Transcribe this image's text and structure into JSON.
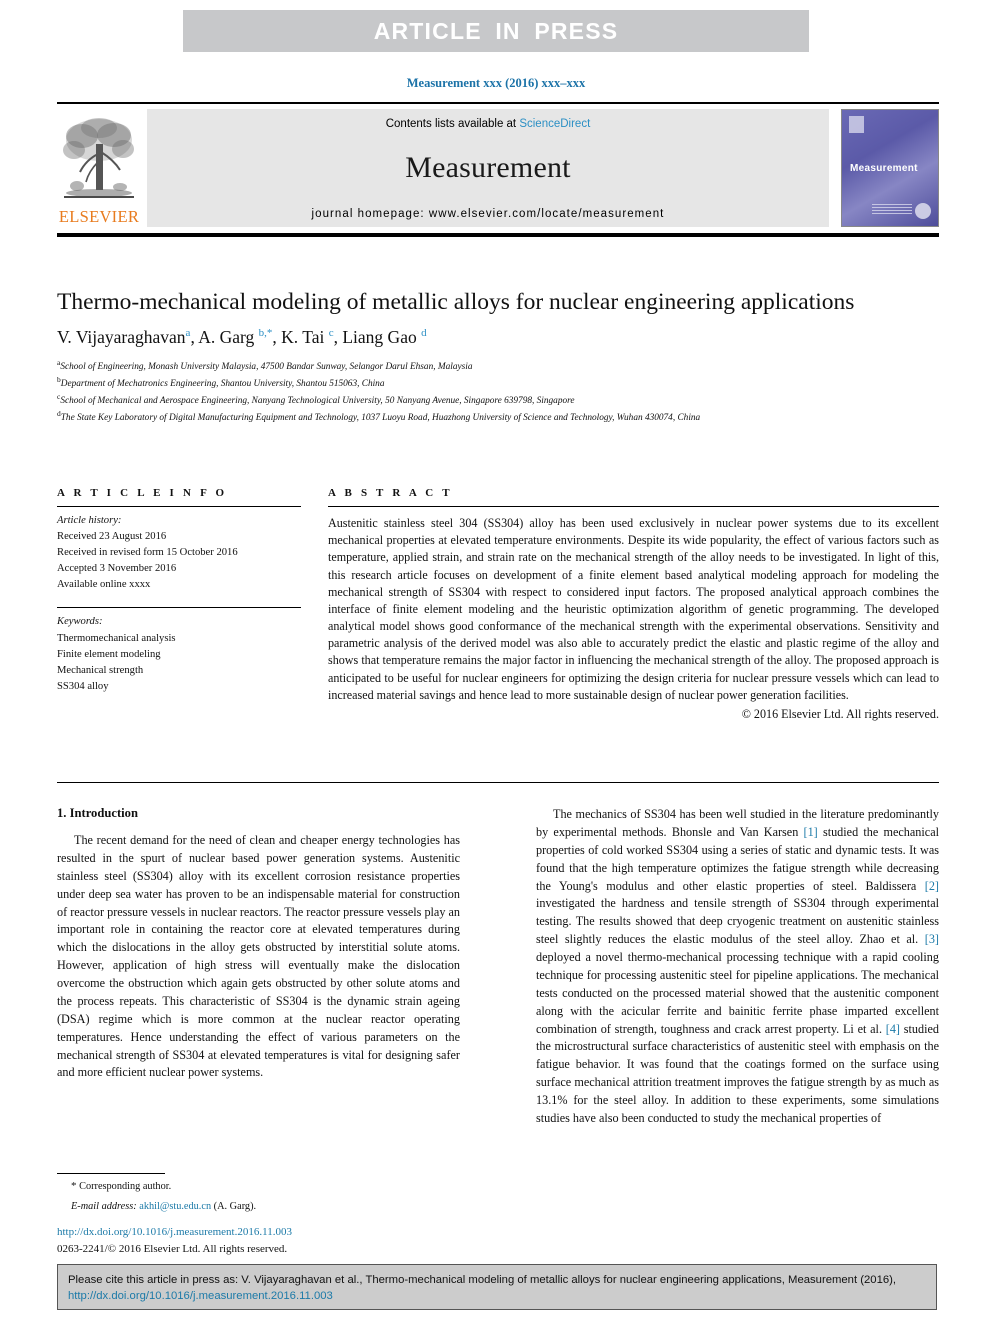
{
  "banner": {
    "label": "ARTICLE  IN  PRESS",
    "bg_color": "#c7c8ca",
    "text_color": "#ffffff"
  },
  "running_head": "Measurement xxx (2016) xxx–xxx",
  "masthead": {
    "contents_prefix": "Contents lists available at ",
    "sciencedirect": "ScienceDirect",
    "journal_name": "Measurement",
    "homepage": "journal homepage: www.elsevier.com/locate/measurement",
    "publisher_logo_text": "ELSEVIER",
    "publisher_logo_color": "#e87b1e",
    "cover_title": "Measurement",
    "link_color": "#2b8fc4"
  },
  "article": {
    "title": "Thermo-mechanical modeling of metallic alloys for nuclear engineering applications",
    "authors_plain": "V. Vijayaraghavan a, A. Garg b,*, K. Tai c, Liang Gao d",
    "author_list": [
      {
        "name": "V. Vijayaraghavan",
        "sup": "a"
      },
      {
        "name": "A. Garg",
        "sup": "b,*"
      },
      {
        "name": "K. Tai",
        "sup": "c"
      },
      {
        "name": "Liang Gao",
        "sup": "d"
      }
    ],
    "affiliations": [
      {
        "marker": "a",
        "text": "School of Engineering, Monash University Malaysia, 47500 Bandar Sunway, Selangor Darul Ehsan, Malaysia"
      },
      {
        "marker": "b",
        "text": "Department of Mechatronics Engineering, Shantou University, Shantou 515063, China"
      },
      {
        "marker": "c",
        "text": "School of Mechanical and Aerospace Engineering, Nanyang Technological University, 50 Nanyang Avenue, Singapore 639798, Singapore"
      },
      {
        "marker": "d",
        "text": "The State Key Laboratory of Digital Manufacturing Equipment and Technology, 1037 Luoyu Road, Huazhong University of Science and Technology, Wuhan 430074, China"
      }
    ]
  },
  "article_info": {
    "heading": "A R T I C L E   I N F O",
    "history_label": "Article history:",
    "history": [
      "Received 23 August 2016",
      "Received in revised form 15 October 2016",
      "Accepted 3 November 2016",
      "Available online xxxx"
    ],
    "keywords_label": "Keywords:",
    "keywords": [
      "Thermomechanical analysis",
      "Finite element modeling",
      "Mechanical strength",
      "SS304 alloy"
    ]
  },
  "abstract": {
    "heading": "A B S T R A C T",
    "text": "Austenitic stainless steel 304 (SS304) alloy has been used exclusively in nuclear power systems due to its excellent mechanical properties at elevated temperature environments. Despite its wide popularity, the effect of various factors such as temperature, applied strain, and strain rate on the mechanical strength of the alloy needs to be investigated. In light of this, this research article focuses on development of a finite element based analytical modeling approach for modeling the mechanical strength of SS304 with respect to considered input factors. The proposed analytical approach combines the interface of finite element modeling and the heuristic optimization algorithm of genetic programming. The developed analytical model shows good conformance of the mechanical strength with the experimental observations. Sensitivity and parametric analysis of the derived model was also able to accurately predict the elastic and plastic regime of the alloy and shows that temperature remains the major factor in influencing the mechanical strength of the alloy. The proposed approach is anticipated to be useful for nuclear engineers for optimizing the design criteria for nuclear pressure vessels which can lead to increased material savings and hence lead to more sustainable design of nuclear power generation facilities.",
    "copyright": "© 2016 Elsevier Ltd. All rights reserved."
  },
  "body": {
    "section_title": "1. Introduction",
    "left_paragraph": "The recent demand for the need of clean and cheaper energy technologies has resulted in the spurt of nuclear based power generation systems. Austenitic stainless steel (SS304) alloy with its excellent corrosion resistance properties under deep sea water has proven to be an indispensable material for construction of reactor pressure vessels in nuclear reactors. The reactor pressure vessels play an important role in containing the reactor core at elevated temperatures during which the dislocations in the alloy gets obstructed by interstitial solute atoms. However, application of high stress will eventually make the dislocation overcome the obstruction which again gets obstructed by other solute atoms and the process repeats. This characteristic of SS304 is the dynamic strain ageing (DSA) regime which is more common at the nuclear reactor operating temperatures. Hence understanding the effect of various parameters on the mechanical strength of SS304 at elevated temperatures is vital for designing safer and more efficient nuclear power systems.",
    "right_paragraph_parts": [
      "The mechanics of SS304 has been well studied in the literature predominantly by experimental methods. Bhonsle and Van Karsen ",
      "[1]",
      " studied the mechanical properties of cold worked SS304 using a series of static and dynamic tests. It was found that the high temperature optimizes the fatigue strength while decreasing the Young's modulus and other elastic properties of steel. Baldissera ",
      "[2]",
      " investigated the hardness and tensile strength of SS304 through experimental testing. The results showed that deep cryogenic treatment on austenitic stainless steel slightly reduces the elastic modulus of the steel alloy. Zhao et al. ",
      "[3]",
      " deployed a novel thermo-mechanical processing technique with a rapid cooling technique for processing austenitic steel for pipeline applications. The mechanical tests conducted on the processed material showed that the austenitic component along with the acicular ferrite and bainitic ferrite phase imparted excellent combination of strength, toughness and crack arrest property. Li et al. ",
      "[4]",
      " studied the microstructural surface characteristics of austenitic steel with emphasis on the fatigue behavior. It was found that the coatings formed on the surface using surface mechanical attrition treatment improves the fatigue strength by as much as 13.1% for the steel alloy. In addition to these experiments, some simulations studies have also been conducted to study the mechanical properties of"
    ],
    "reference_link_color": "#1c7aa8"
  },
  "footnote": {
    "corresponding_marker": "*",
    "corresponding_text": "Corresponding author.",
    "email_label": "E-mail address:",
    "email": "akhil@stu.edu.cn",
    "email_suffix": "(A. Garg)."
  },
  "publication": {
    "doi_url": "http://dx.doi.org/10.1016/j.measurement.2016.11.003",
    "issn_line": "0263-2241/© 2016 Elsevier Ltd. All rights reserved."
  },
  "cite_box": {
    "text_before": "Please cite this article in press as: V. Vijayaraghavan et al., Thermo-mechanical modeling of metallic alloys for nuclear engineering applications, Measurement (2016), ",
    "doi": "http://dx.doi.org/10.1016/j.measurement.2016.11.003",
    "bg_color": "#cccccc"
  }
}
